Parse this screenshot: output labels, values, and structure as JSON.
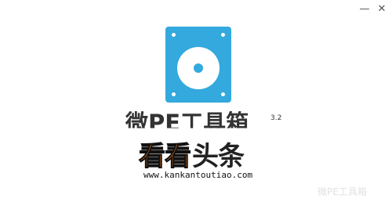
{
  "window": {
    "minimize_glyph": "—",
    "close_glyph": "✕"
  },
  "app": {
    "title": "微PE工具箱",
    "version": "3.2",
    "icon": "hard-disk-icon",
    "icon_color": "#33a9dd"
  },
  "watermark": {
    "brand_part1": "看看",
    "brand_part2": "头条",
    "url": "www.kankantoutiao.com",
    "accent_color": "#ff7d14",
    "text_color": "#222222"
  },
  "bottom_text": "微PE工具箱"
}
